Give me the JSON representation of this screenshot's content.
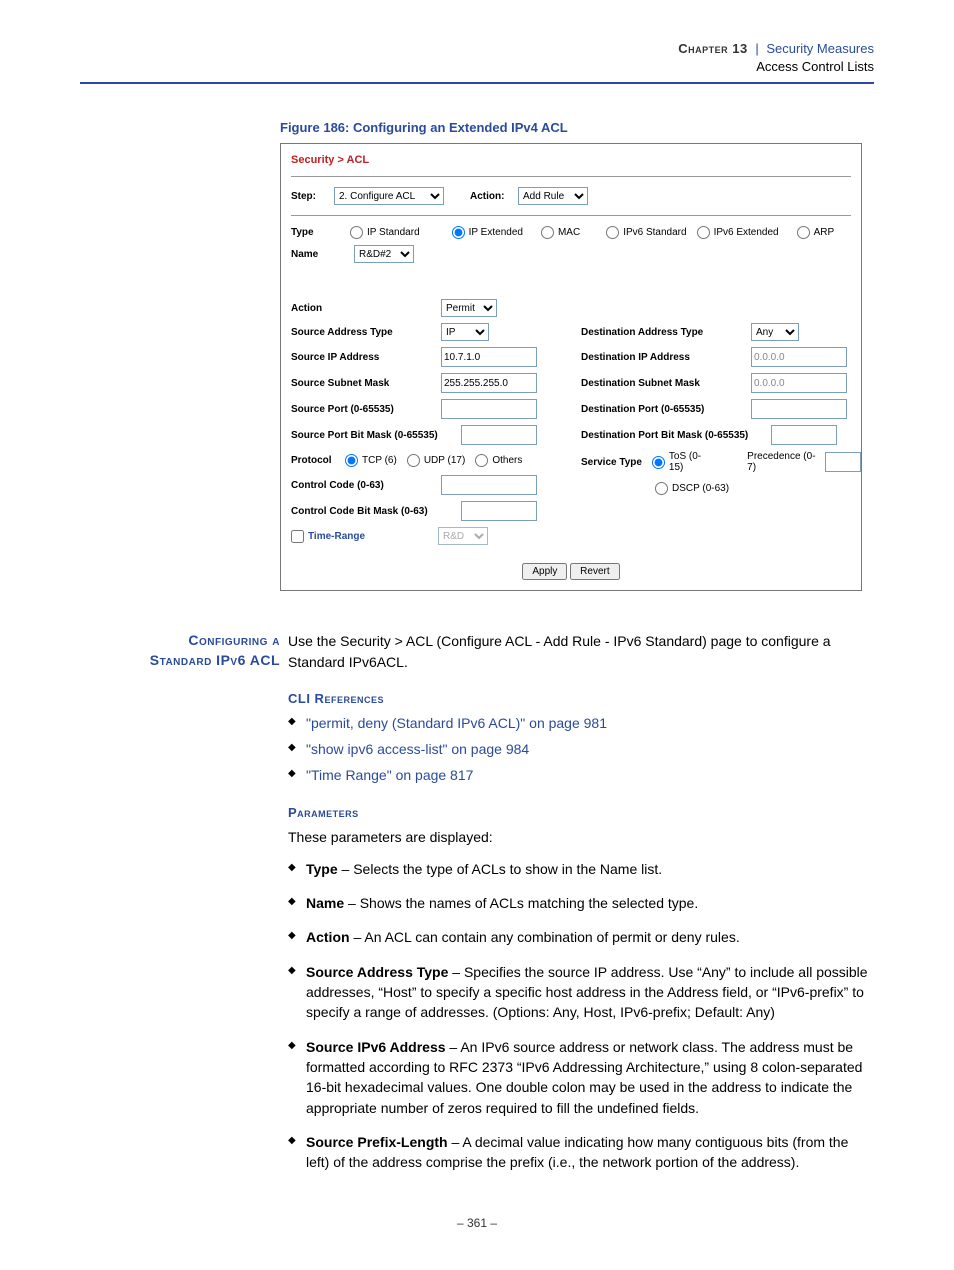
{
  "header": {
    "chapter": "Chapter 13",
    "title": "Security Measures",
    "subtitle": "Access Control Lists"
  },
  "figure": {
    "caption": "Figure 186:  Configuring an Extended IPv4 ACL"
  },
  "shot": {
    "breadcrumb": "Security > ACL",
    "step_label": "Step:",
    "step_value": "2. Configure ACL",
    "action_label": "Action:",
    "action_value": "Add Rule",
    "type_label": "Type",
    "types": [
      "IP Standard",
      "IP Extended",
      "MAC",
      "IPv6 Standard",
      "IPv6 Extended",
      "ARP"
    ],
    "type_selected": "IP Extended",
    "name_label": "Name",
    "name_value": "R&D#2",
    "action2_label": "Action",
    "action2_value": "Permit",
    "left": {
      "sat": "Source Address Type",
      "sat_v": "IP",
      "sip": "Source IP Address",
      "sip_v": "10.7.1.0",
      "ssm": "Source Subnet Mask",
      "ssm_v": "255.255.255.0",
      "sp": "Source Port (0-65535)",
      "sp_v": "",
      "spm": "Source Port Bit Mask (0-65535)",
      "spm_v": "",
      "proto": "Protocol",
      "proto_opts": [
        "TCP (6)",
        "UDP (17)",
        "Others"
      ],
      "proto_sel": "TCP (6)",
      "cc": "Control Code (0-63)",
      "cc_v": "",
      "ccm": "Control Code Bit Mask (0-63)",
      "ccm_v": "",
      "tr": "Time-Range",
      "tr_v": "R&D"
    },
    "right": {
      "dat": "Destination Address Type",
      "dat_v": "Any",
      "dip": "Destination IP Address",
      "dip_v": "0.0.0.0",
      "dsm": "Destination Subnet Mask",
      "dsm_v": "0.0.0.0",
      "dp": "Destination Port (0-65535)",
      "dp_v": "",
      "dpm": "Destination Port Bit Mask (0-65535)",
      "dpm_v": "",
      "svc": "Service Type",
      "svc_opts": [
        "ToS (0-15)",
        "DSCP (0-63)"
      ],
      "svc_sel": "ToS (0-15)",
      "prec": "Precedence (0-7)"
    },
    "apply": "Apply",
    "revert": "Revert"
  },
  "section_head_l1": "Configuring a",
  "section_head_l2": "Standard IPv6 ACL",
  "intro": "Use the Security > ACL (Configure ACL - Add Rule - IPv6 Standard) page to configure a Standard IPv6ACL.",
  "cli_head": "CLI References",
  "cli": [
    "\"permit, deny (Standard IPv6 ACL)\" on page 981",
    "\"show ipv6 access-list\" on page 984",
    "\"Time Range\" on page 817"
  ],
  "param_head": "Parameters",
  "param_intro": "These parameters are displayed:",
  "params": [
    {
      "t": "Type",
      "d": " – Selects the type of ACLs to show in the Name list."
    },
    {
      "t": "Name",
      "d": " – Shows the names of ACLs matching the selected type."
    },
    {
      "t": "Action",
      "d": " – An ACL can contain any combination of permit or deny rules."
    },
    {
      "t": "Source Address Type",
      "d": " – Specifies the source IP address. Use “Any” to include all possible addresses, “Host” to specify a specific host address in the Address field, or “IPv6-prefix” to specify a range of addresses. (Options: Any, Host, IPv6-prefix; Default: Any)"
    },
    {
      "t": "Source IPv6 Address",
      "d": " – An IPv6 source address or network class. The address must be formatted according to RFC 2373 “IPv6 Addressing Architecture,” using 8 colon-separated 16-bit hexadecimal values. One double colon may be used in the address to indicate the appropriate number of zeros required to fill the undefined fields."
    },
    {
      "t": "Source Prefix-Length",
      "d": " – A decimal value indicating how many contiguous bits (from the left) of the address comprise the prefix (i.e., the network portion of the address)."
    }
  ],
  "page_num": "–  361  –"
}
